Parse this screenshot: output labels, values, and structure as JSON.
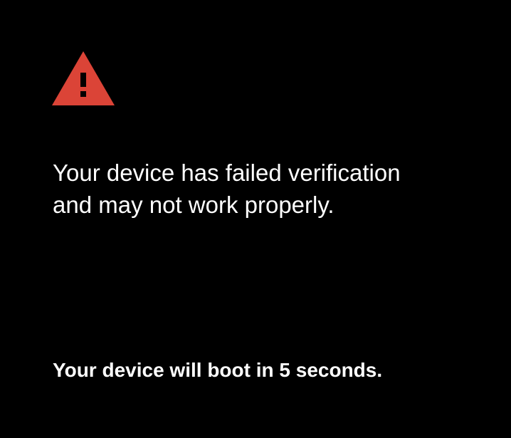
{
  "screen": {
    "icon": "warning-triangle-icon",
    "message_line1": "Your device has failed verification",
    "message_line2": "and may not work properly.",
    "boot_status": "Your device will boot in 5 seconds."
  },
  "colors": {
    "background": "#000000",
    "text": "#ffffff",
    "warning": "#db4437"
  }
}
